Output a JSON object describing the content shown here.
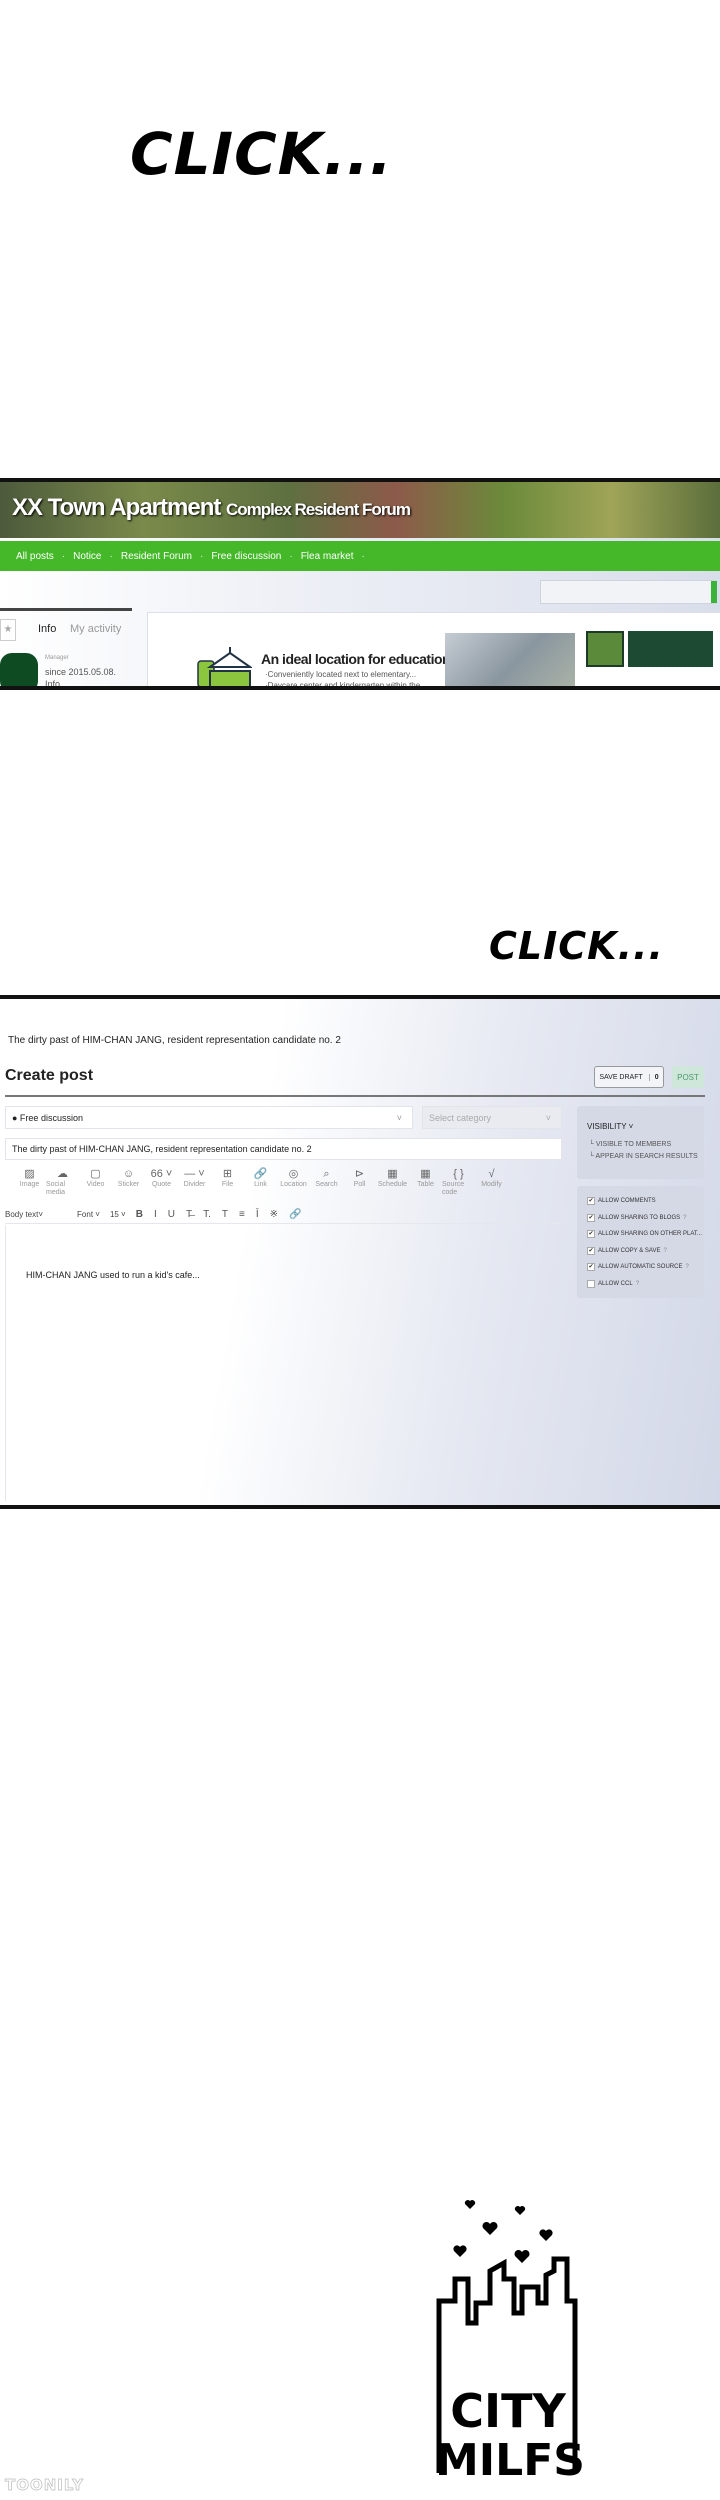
{
  "captions": {
    "click1": "CLICK...",
    "click2": "CLICK..."
  },
  "forum": {
    "title_main": "XX Town Apartment",
    "title_sub": "Complex Resident Forum",
    "nav": [
      "All posts",
      "Notice",
      "Resident Forum",
      "Free discussion",
      "Flea market"
    ],
    "nav_separator": "·",
    "profile": {
      "tab_info": "Info",
      "tab_activity": "My activity",
      "role": "Manager",
      "since": "since 2015.05.08.",
      "info": "Info"
    },
    "promo": {
      "title": "An ideal location for education",
      "lines": [
        "·Conveniently located next to elementary...",
        "·Daycare center and kindergarten within the..."
      ]
    },
    "accent": "#45b82a"
  },
  "editor": {
    "page_title": "The dirty past of HIM-CHAN JANG, resident representation candidate no. 2",
    "heading": "Create post",
    "save_draft": "SAVE DRAFT",
    "draft_count": "0",
    "post": "POST",
    "board": "● Free discussion",
    "category_placeholder": "Select category",
    "subject": "The dirty past of HIM-CHAN JANG, resident representation candidate no. 2",
    "tools": [
      {
        "label": "Image",
        "icon": "image-icon",
        "glyph": "▨"
      },
      {
        "label": "Social media",
        "icon": "cloud-icon",
        "glyph": "☁"
      },
      {
        "label": "Video",
        "icon": "video-icon",
        "glyph": "▢"
      },
      {
        "label": "Sticker",
        "icon": "smiley-icon",
        "glyph": "☺"
      },
      {
        "label": "Quote",
        "icon": "quote-icon",
        "glyph": "66 ˅"
      },
      {
        "label": "Divider",
        "icon": "divider-icon",
        "glyph": "— ˅"
      },
      {
        "label": "File",
        "icon": "file-icon",
        "glyph": "⊞"
      },
      {
        "label": "Link",
        "icon": "link-icon",
        "glyph": "🔗"
      },
      {
        "label": "Location",
        "icon": "location-icon",
        "glyph": "◎"
      },
      {
        "label": "Search",
        "icon": "search-icon",
        "glyph": "⌕"
      },
      {
        "label": "Poll",
        "icon": "poll-icon",
        "glyph": "⊳"
      },
      {
        "label": "Schedule",
        "icon": "calendar-icon",
        "glyph": "▦"
      },
      {
        "label": "Table",
        "icon": "table-icon",
        "glyph": "▦"
      },
      {
        "label": "Source code",
        "icon": "code-icon",
        "glyph": "{ }"
      },
      {
        "label": "Modify",
        "icon": "formula-icon",
        "glyph": "√"
      }
    ],
    "format": {
      "style": "Body text˅",
      "font": "Font ˅",
      "size": "15 ˅",
      "buttons": [
        "B",
        "I",
        "U",
        "T̶",
        "T.",
        "T",
        "≡",
        "Ī",
        "※",
        "🔗"
      ]
    },
    "body": "HIM-CHAN JANG used to run a kid's cafe...",
    "visibility": {
      "heading": "VISIBILITY ˅",
      "items": [
        "└ VISIBLE TO MEMBERS",
        "└ APPEAR IN SEARCH RESULTS"
      ]
    },
    "options": [
      {
        "label": "ALLOW COMMENTS",
        "checked": true,
        "help": ""
      },
      {
        "label": "ALLOW SHARING TO BLOGS",
        "checked": true,
        "help": "?"
      },
      {
        "label": "ALLOW SHARING ON OTHER PLAT...",
        "checked": true,
        "help": ""
      },
      {
        "label": "ALLOW COPY & SAVE",
        "checked": true,
        "help": "?"
      },
      {
        "label": "ALLOW AUTOMATIC SOURCE",
        "checked": true,
        "help": "?"
      },
      {
        "label": "ALLOW CCL",
        "checked": false,
        "help": "?"
      }
    ]
  },
  "logo": {
    "text_line1": "CITY",
    "text_line2": "MILFS"
  },
  "watermark": "TOONILY"
}
